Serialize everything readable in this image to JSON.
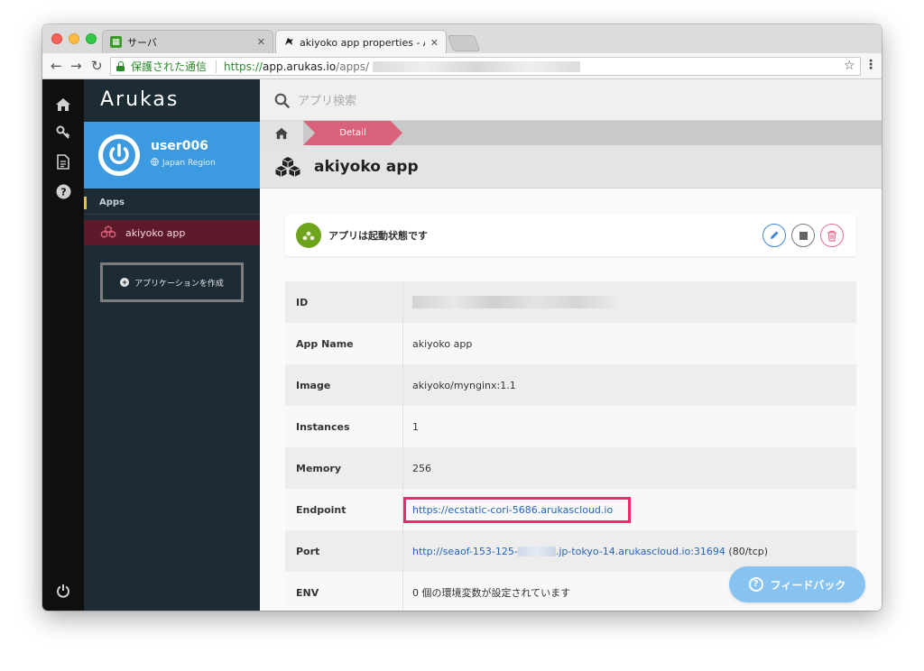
{
  "browser": {
    "tabs": [
      {
        "title": "サーバ",
        "favicon": "sheet-icon"
      },
      {
        "title": "akiyoko app properties - Aruk",
        "favicon": "bird-icon"
      }
    ],
    "address": {
      "secure_label": "保護された通信",
      "scheme": "https://",
      "host": "app.arukas.io",
      "path": "/apps/"
    }
  },
  "sidebar": {
    "logo": "Arukas",
    "user": {
      "name": "user006",
      "region": "Japan Region"
    },
    "section_label": "Apps",
    "apps": [
      {
        "label": "akiyoko app"
      }
    ],
    "create_button": "アプリケーションを作成"
  },
  "main": {
    "search_placeholder": "アプリ検索",
    "breadcrumb": {
      "current": "Detail"
    },
    "title": "akiyoko app",
    "status_text": "アプリは起動状態です",
    "properties": [
      {
        "key": "ID",
        "value": ""
      },
      {
        "key": "App Name",
        "value": "akiyoko app"
      },
      {
        "key": "Image",
        "value": "akiyoko/mynginx:1.1"
      },
      {
        "key": "Instances",
        "value": "1"
      },
      {
        "key": "Memory",
        "value": "256"
      },
      {
        "key": "Endpoint",
        "value": "https://ecstatic-cori-5686.arukascloud.io"
      },
      {
        "key": "Port",
        "value_prefix": "http://seaof-153-125-",
        "value_suffix": ".jp-tokyo-14.arukascloud.io:31694",
        "note": " (80/tcp)"
      },
      {
        "key": "ENV",
        "value": "0 個の環境変数が設定されています"
      }
    ],
    "feedback_label": "フィードバック"
  },
  "colors": {
    "sidebar_bg": "#1d2b34",
    "user_card": "#3c9ae0",
    "active_app": "#5e1a2b",
    "breadcrumb_active": "#d9627a",
    "status_green": "#6ea31c",
    "highlight": "#ee2a6c",
    "feedback": "#87c3f0"
  }
}
